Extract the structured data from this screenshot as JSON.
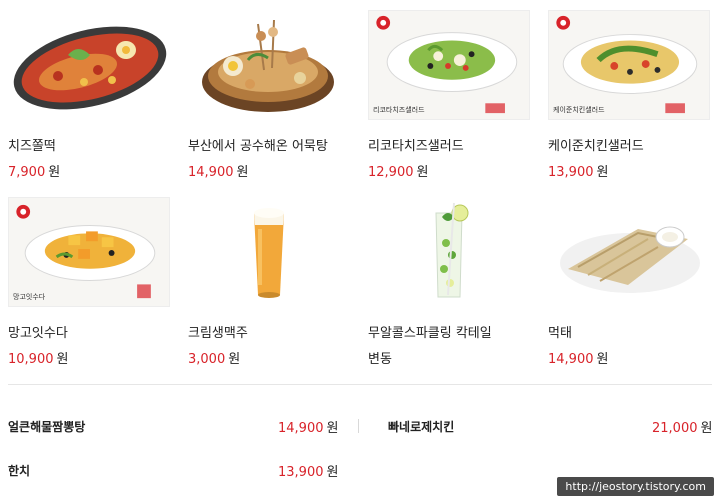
{
  "menu": [
    {
      "name": "치즈쫄떡",
      "price": "7,900",
      "unit": "원"
    },
    {
      "name": "부산에서 공수해온 어묵탕",
      "price": "14,900",
      "unit": "원"
    },
    {
      "name": "리코타치즈샐러드",
      "price": "12,900",
      "unit": "원"
    },
    {
      "name": "케이준치킨샐러드",
      "price": "13,900",
      "unit": "원"
    },
    {
      "name": "망고잇수다",
      "price": "10,900",
      "unit": "원"
    },
    {
      "name": "크림생맥주",
      "price": "3,000",
      "unit": "원"
    },
    {
      "name": "무알콜스파클링 칵테일",
      "price_text": "변동"
    },
    {
      "name": "먹태",
      "price": "14,900",
      "unit": "원"
    }
  ],
  "thumb_captions": {
    "ricotta": "리코타치즈샐러드",
    "cajun": "케이준치킨샐러드",
    "mango": "망고잇수다"
  },
  "extras": [
    {
      "name": "얼큰해물짬뽕탕",
      "price": "14,900",
      "unit": "원"
    },
    {
      "name": "빠네로제치킨",
      "price": "21,000",
      "unit": "원"
    },
    {
      "name": "한치",
      "price": "13,900",
      "unit": "원"
    }
  ],
  "watermark": "http://jeostory.tistory.com",
  "colors": {
    "price": "#d8232a",
    "text": "#222222",
    "divider": "#e6e6e6"
  },
  "icons": [
    "tteokbokki-photo",
    "fishcake-soup-photo",
    "ricotta-salad-photo",
    "cajun-salad-photo",
    "mango-dessert-photo",
    "beer-photo",
    "mojito-photo",
    "dried-pollack-photo"
  ]
}
